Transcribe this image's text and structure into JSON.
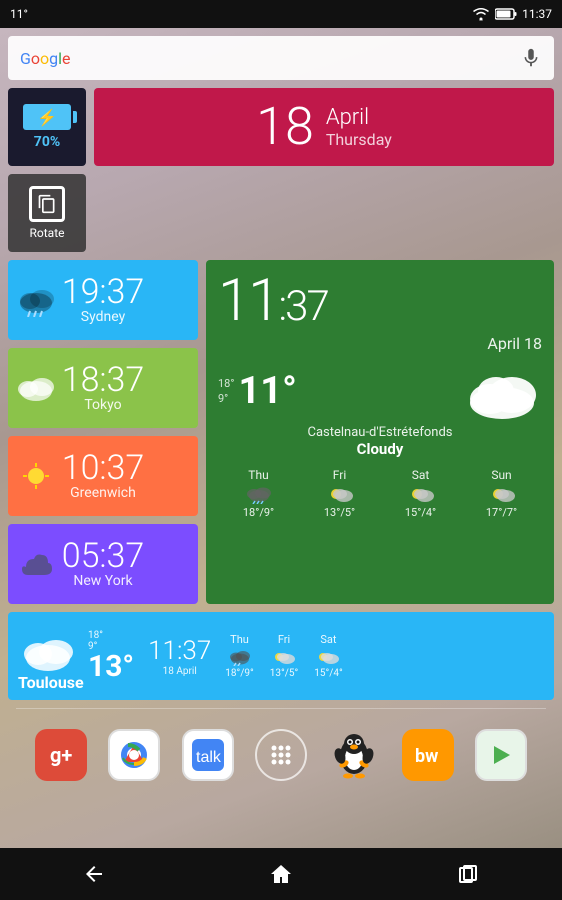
{
  "statusBar": {
    "signal": "11°",
    "wifi": "wifi",
    "battery": "battery",
    "time": "11:37"
  },
  "searchBar": {
    "placeholder": "Google",
    "micIcon": "microphone"
  },
  "batteryWidget": {
    "percent": "70%",
    "icon": "battery-charging"
  },
  "rotateWidget": {
    "label": "Rotate"
  },
  "dateWidget": {
    "day": "18",
    "month": "April",
    "weekday": "Thursday"
  },
  "cityClocks": [
    {
      "time": "19:37",
      "city": "Sydney",
      "color": "#29b6f6"
    },
    {
      "time": "18:37",
      "city": "Tokyo",
      "color": "#8bc34a"
    },
    {
      "time": "10:37",
      "city": "Greenwich",
      "color": "#ff7043"
    },
    {
      "time": "05:37",
      "city": "New York",
      "color": "#7c4dff"
    }
  ],
  "mainWeather": {
    "time": "11:37",
    "date": "April 18",
    "hiTemp": "18°",
    "loTemp": "9°",
    "temp": "11°",
    "location": "Castelnau-d'Estrétefonds",
    "condition": "Cloudy",
    "forecast": [
      {
        "day": "Thu",
        "hi": "18°",
        "lo": "9°"
      },
      {
        "day": "Fri",
        "hi": "13°",
        "lo": "5°"
      },
      {
        "day": "Sat",
        "hi": "15°",
        "lo": "4°"
      },
      {
        "day": "Sun",
        "hi": "17°",
        "lo": "7°"
      }
    ]
  },
  "bottomWeather": {
    "city": "Toulouse",
    "hiTemp": "18°",
    "loTemp": "9°",
    "temp": "13°",
    "time": "11:37",
    "date": "18 April",
    "forecast": [
      {
        "day": "Thu",
        "hi": "18°",
        "lo": "9°"
      },
      {
        "day": "Fri",
        "hi": "13°",
        "lo": "5°"
      },
      {
        "day": "Sat",
        "hi": "15°",
        "lo": "4°"
      }
    ]
  },
  "apps": [
    {
      "name": "Google+",
      "id": "gplus"
    },
    {
      "name": "Chrome",
      "id": "chrome"
    },
    {
      "name": "Talk",
      "id": "talk"
    },
    {
      "name": "Apps",
      "id": "apps"
    },
    {
      "name": "Penguin",
      "id": "penguin"
    },
    {
      "name": "BW",
      "id": "bw"
    },
    {
      "name": "Play Store",
      "id": "play"
    }
  ],
  "nav": {
    "back": "←",
    "home": "⌂",
    "recent": "▭"
  }
}
